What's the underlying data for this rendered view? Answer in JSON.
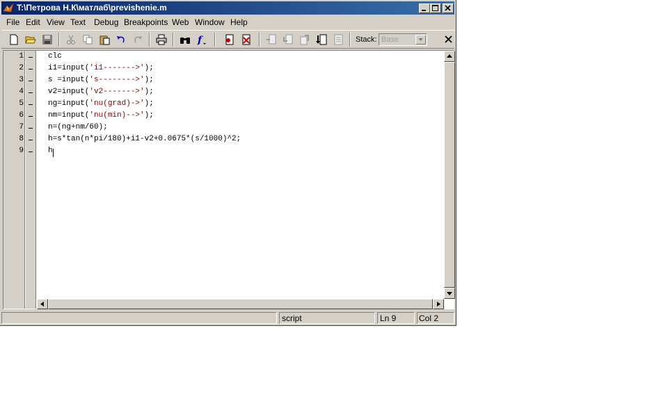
{
  "window": {
    "title": "T:\\Петрова Н.К\\матлаб\\previshenie.m"
  },
  "menu": [
    "File",
    "Edit",
    "View",
    "Text",
    "Debug",
    "Breakpoints",
    "Web",
    "Window",
    "Help"
  ],
  "toolbar": {
    "icons": [
      "new-file-icon",
      "open-folder-icon",
      "save-icon",
      "cut-icon",
      "copy-icon",
      "paste-icon",
      "undo-icon",
      "redo-icon",
      "print-icon",
      "find-icon",
      "function-icon",
      "set-breakpoint-icon",
      "clear-breakpoints-icon",
      "step-icon",
      "step-in-icon",
      "step-out-icon",
      "continue-icon",
      "exit-debug-icon"
    ],
    "stack_label": "Stack:",
    "stack_value": "Base"
  },
  "editor": {
    "lines": [
      {
        "num": "1",
        "code": "clc"
      },
      {
        "num": "2",
        "code": "i1=input('i1------->');"
      },
      {
        "num": "3",
        "code": "s =input('s-------->');"
      },
      {
        "num": "4",
        "code": "v2=input('v2------->');"
      },
      {
        "num": "5",
        "code": "ng=input('nu(grad)->');"
      },
      {
        "num": "6",
        "code": "nm=input('nu(min)-->');"
      },
      {
        "num": "7",
        "code": "n=(ng+nm/60);"
      },
      {
        "num": "8",
        "code": "h=s*tan(n*pi/180)+i1-v2+0.0675*(s/1000)^2;"
      },
      {
        "num": "9",
        "code": "h"
      }
    ]
  },
  "status": {
    "type": "script",
    "line": "Ln 9",
    "col": "Col 2"
  },
  "colors": {
    "titlebar_start": "#0a246a",
    "titlebar_end": "#3a6ea5",
    "string": "#a020f0",
    "chrome": "#d4d0c8"
  }
}
